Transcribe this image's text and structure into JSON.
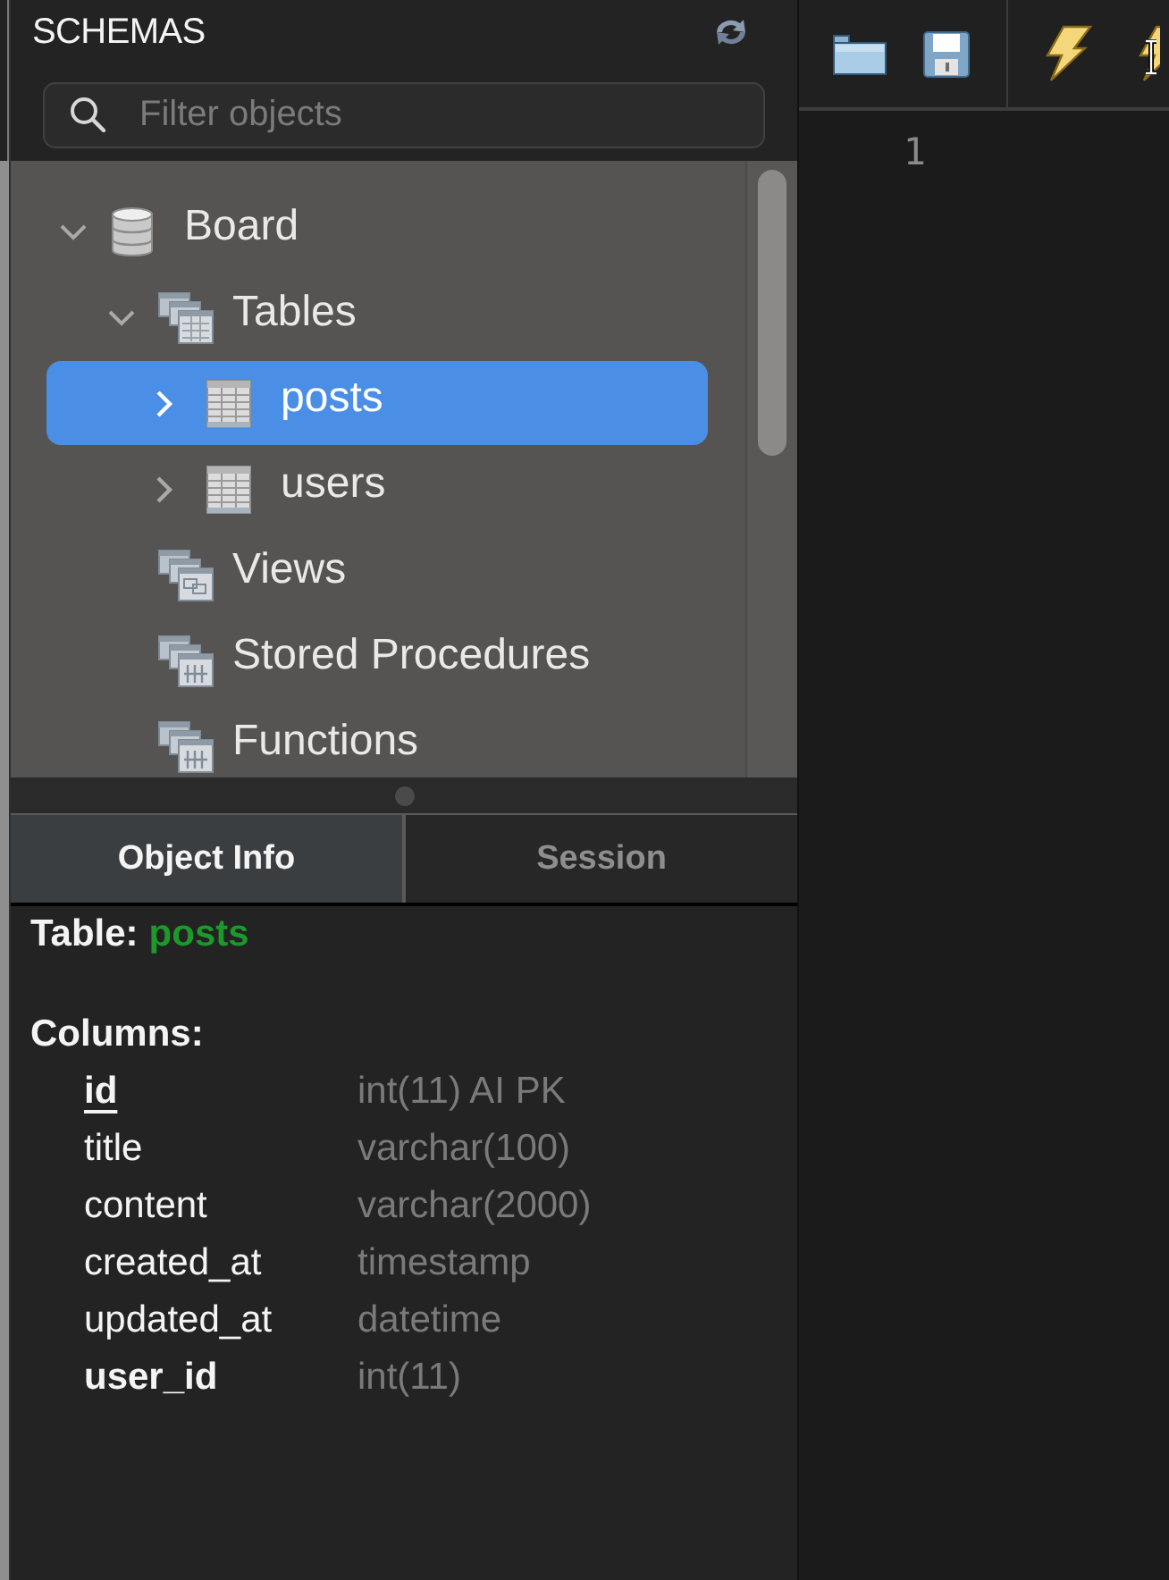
{
  "sidebar": {
    "title": "SCHEMAS",
    "search": {
      "placeholder": "Filter objects"
    },
    "tree": [
      {
        "label": "Board",
        "kind": "schema",
        "expanded": true,
        "selected": false,
        "children": [
          {
            "label": "Tables",
            "kind": "tables",
            "expanded": true,
            "selected": false,
            "children": [
              {
                "label": "posts",
                "kind": "table",
                "expanded": false,
                "selected": true
              },
              {
                "label": "users",
                "kind": "table",
                "expanded": false,
                "selected": false
              }
            ]
          },
          {
            "label": "Views",
            "kind": "views",
            "selected": false
          },
          {
            "label": "Stored Procedures",
            "kind": "procedures",
            "selected": false
          },
          {
            "label": "Functions",
            "kind": "functions",
            "selected": false
          }
        ]
      }
    ]
  },
  "info_panel": {
    "tabs": [
      {
        "label": "Object Info",
        "selected": true
      },
      {
        "label": "Session",
        "selected": false
      }
    ],
    "object": {
      "type_label": "Table:",
      "name": "posts"
    },
    "columns_label": "Columns:",
    "columns": [
      {
        "name": "id",
        "type": "int(11) AI PK",
        "primary_key": true,
        "indexed": true
      },
      {
        "name": "title",
        "type": "varchar(100)",
        "primary_key": false,
        "indexed": false
      },
      {
        "name": "content",
        "type": "varchar(2000)",
        "primary_key": false,
        "indexed": false
      },
      {
        "name": "created_at",
        "type": "timestamp",
        "primary_key": false,
        "indexed": false
      },
      {
        "name": "updated_at",
        "type": "datetime",
        "primary_key": false,
        "indexed": false
      },
      {
        "name": "user_id",
        "type": "int(11)",
        "primary_key": false,
        "indexed": true
      }
    ]
  },
  "editor": {
    "line_numbers": [
      "1"
    ]
  }
}
